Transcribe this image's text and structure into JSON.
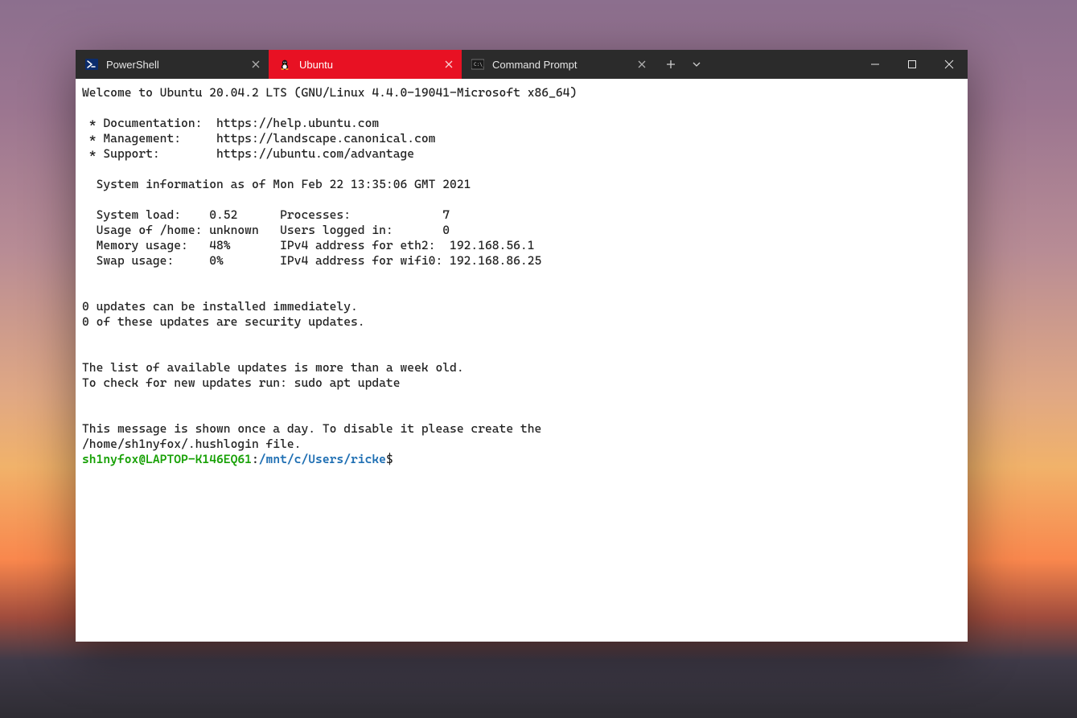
{
  "tabs": [
    {
      "label": "PowerShell",
      "active": false,
      "icon": "powershell"
    },
    {
      "label": "Ubuntu",
      "active": true,
      "icon": "tux"
    },
    {
      "label": "Command Prompt",
      "active": false,
      "icon": "cmd"
    }
  ],
  "terminal": {
    "welcome": "Welcome to Ubuntu 20.04.2 LTS (GNU/Linux 4.4.0-19041-Microsoft x86_64)",
    "doc_line": " * Documentation:  https://help.ubuntu.com",
    "mgmt_line": " * Management:     https://landscape.canonical.com",
    "support_line": " * Support:        https://ubuntu.com/advantage",
    "sysinfo_header": "  System information as of Mon Feb 22 13:35:06 GMT 2021",
    "row1": "  System load:    0.52      Processes:             7",
    "row2": "  Usage of /home: unknown   Users logged in:       0",
    "row3": "  Memory usage:   48%       IPv4 address for eth2:  192.168.56.1",
    "row4": "  Swap usage:     0%        IPv4 address for wifi0: 192.168.86.25",
    "updates1": "0 updates can be installed immediately.",
    "updates2": "0 of these updates are security updates.",
    "stale1": "The list of available updates is more than a week old.",
    "stale2": "To check for new updates run: sudo apt update",
    "motd1": "This message is shown once a day. To disable it please create the",
    "motd2": "/home/sh1nyfox/.hushlogin file.",
    "prompt_user": "sh1nyfox@LAPTOP-K146EQ61",
    "prompt_colon": ":",
    "prompt_path": "/mnt/c/Users/ricke",
    "prompt_symbol": "$"
  }
}
